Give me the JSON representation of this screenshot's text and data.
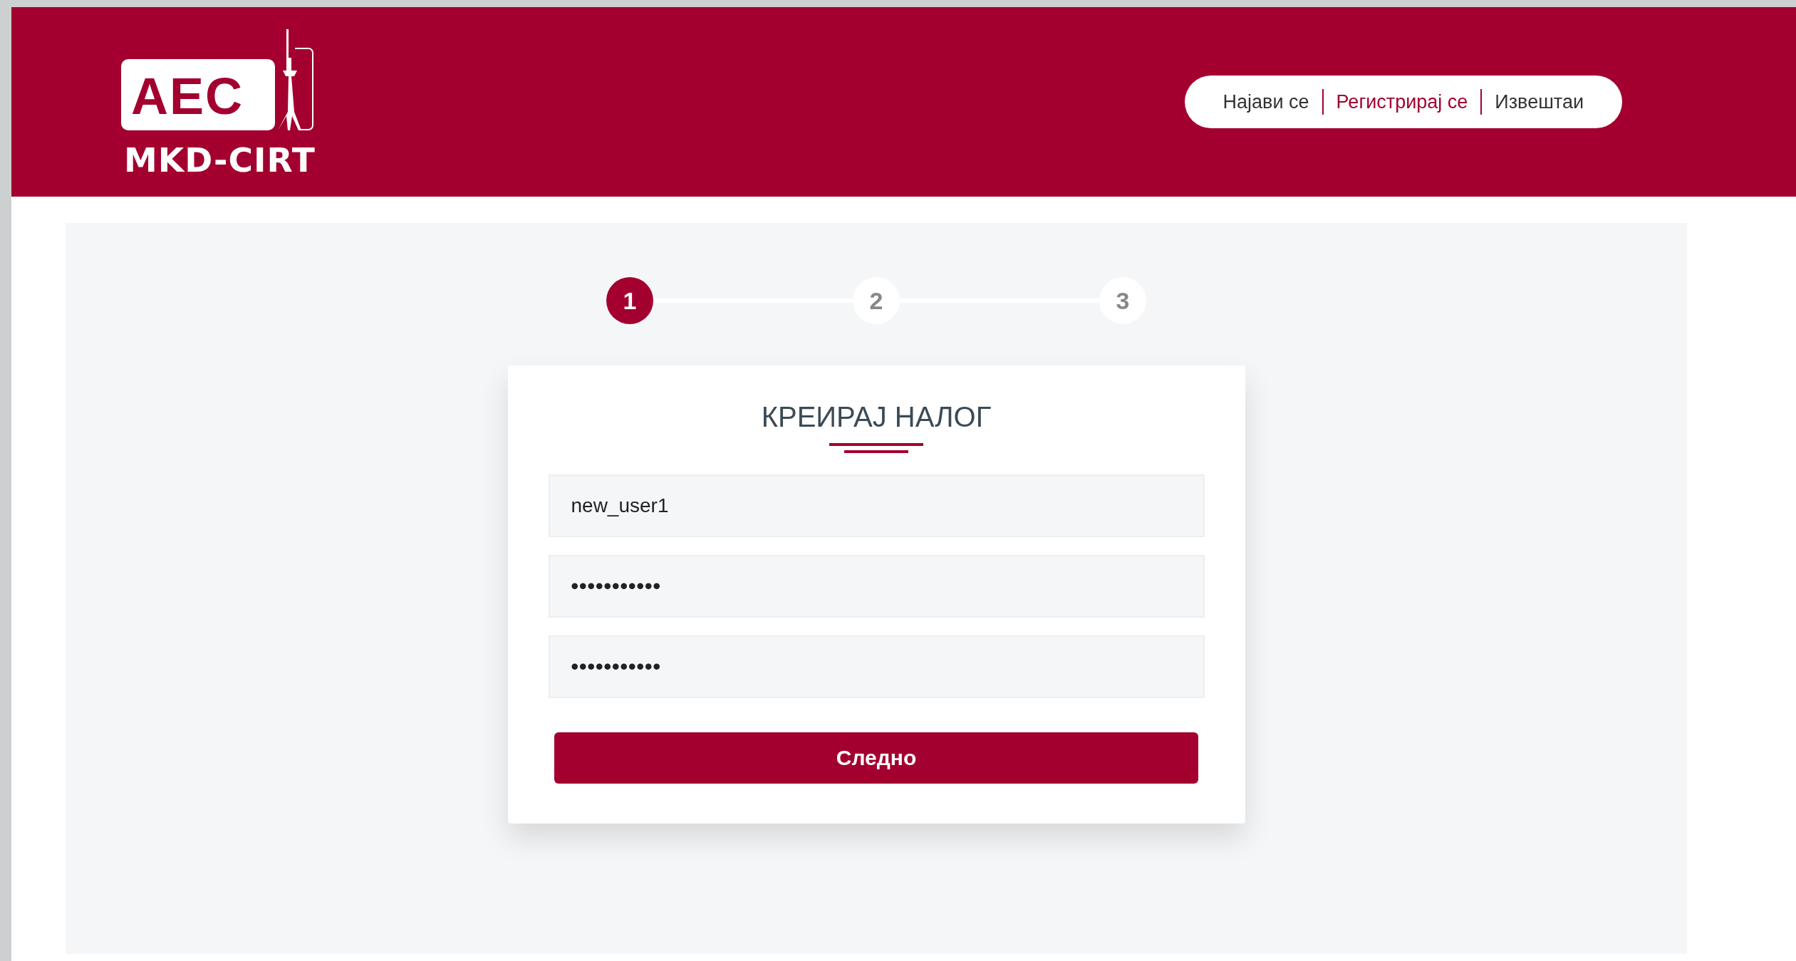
{
  "logo": {
    "mark": "AEC",
    "name": "MKD-CIRT"
  },
  "nav": [
    {
      "label": "Најави се",
      "selected": false
    },
    {
      "label": "Регистрирај се",
      "selected": true
    },
    {
      "label": "Извештаи",
      "selected": false
    }
  ],
  "steps": [
    {
      "label": "1",
      "selected": true
    },
    {
      "label": "2",
      "selected": false
    },
    {
      "label": "3",
      "selected": false
    }
  ],
  "form": {
    "title": "КРЕИРАЈ НАЛОГ",
    "fields": [
      {
        "kind": "text",
        "value": "new_user1"
      },
      {
        "kind": "password",
        "value": "•••••••••••"
      },
      {
        "kind": "password",
        "value": "•••••••••••"
      }
    ],
    "button": "Следно"
  }
}
